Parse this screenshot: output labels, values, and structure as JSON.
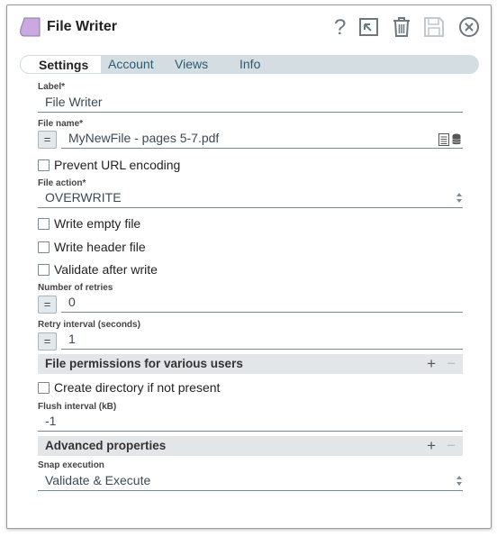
{
  "header": {
    "title": "File Writer",
    "icons": [
      "snap-icon",
      "help-icon",
      "expand-icon",
      "trash-icon",
      "save-icon",
      "close-icon"
    ]
  },
  "tabs": [
    {
      "label": "Settings",
      "active": true
    },
    {
      "label": "Account"
    },
    {
      "label": "Views"
    },
    {
      "label": "Info"
    }
  ],
  "form": {
    "label_field": {
      "label": "Label*",
      "value": "File Writer"
    },
    "file_name": {
      "label": "File name*",
      "eq": "=",
      "value": "MyNewFile - pages 5-7.pdf"
    },
    "prevent_url_encoding": {
      "label": "Prevent URL encoding",
      "checked": false
    },
    "file_action": {
      "label": "File action*",
      "value": "OVERWRITE"
    },
    "write_empty_file": {
      "label": "Write empty file",
      "checked": false
    },
    "write_header_file": {
      "label": "Write header file",
      "checked": false
    },
    "validate_after_write": {
      "label": "Validate after write",
      "checked": false
    },
    "number_of_retries": {
      "label": "Number of retries",
      "eq": "=",
      "value": "0"
    },
    "retry_interval": {
      "label": "Retry interval (seconds)",
      "eq": "=",
      "value": "1"
    },
    "file_permissions": {
      "title": "File permissions for various users",
      "plus": "+",
      "minus": "−"
    },
    "create_directory": {
      "label": "Create directory if not present",
      "checked": false
    },
    "flush_interval": {
      "label": "Flush interval (kB)",
      "value": "-1"
    },
    "advanced_properties": {
      "title": "Advanced properties",
      "plus": "+",
      "minus": "−"
    },
    "snap_execution": {
      "label": "Snap execution",
      "value": "Validate & Execute"
    }
  },
  "colors": {
    "accent": "#2c5b74",
    "snap_icon": "#c9a9e0",
    "tab_bar": "#d4dde2"
  }
}
